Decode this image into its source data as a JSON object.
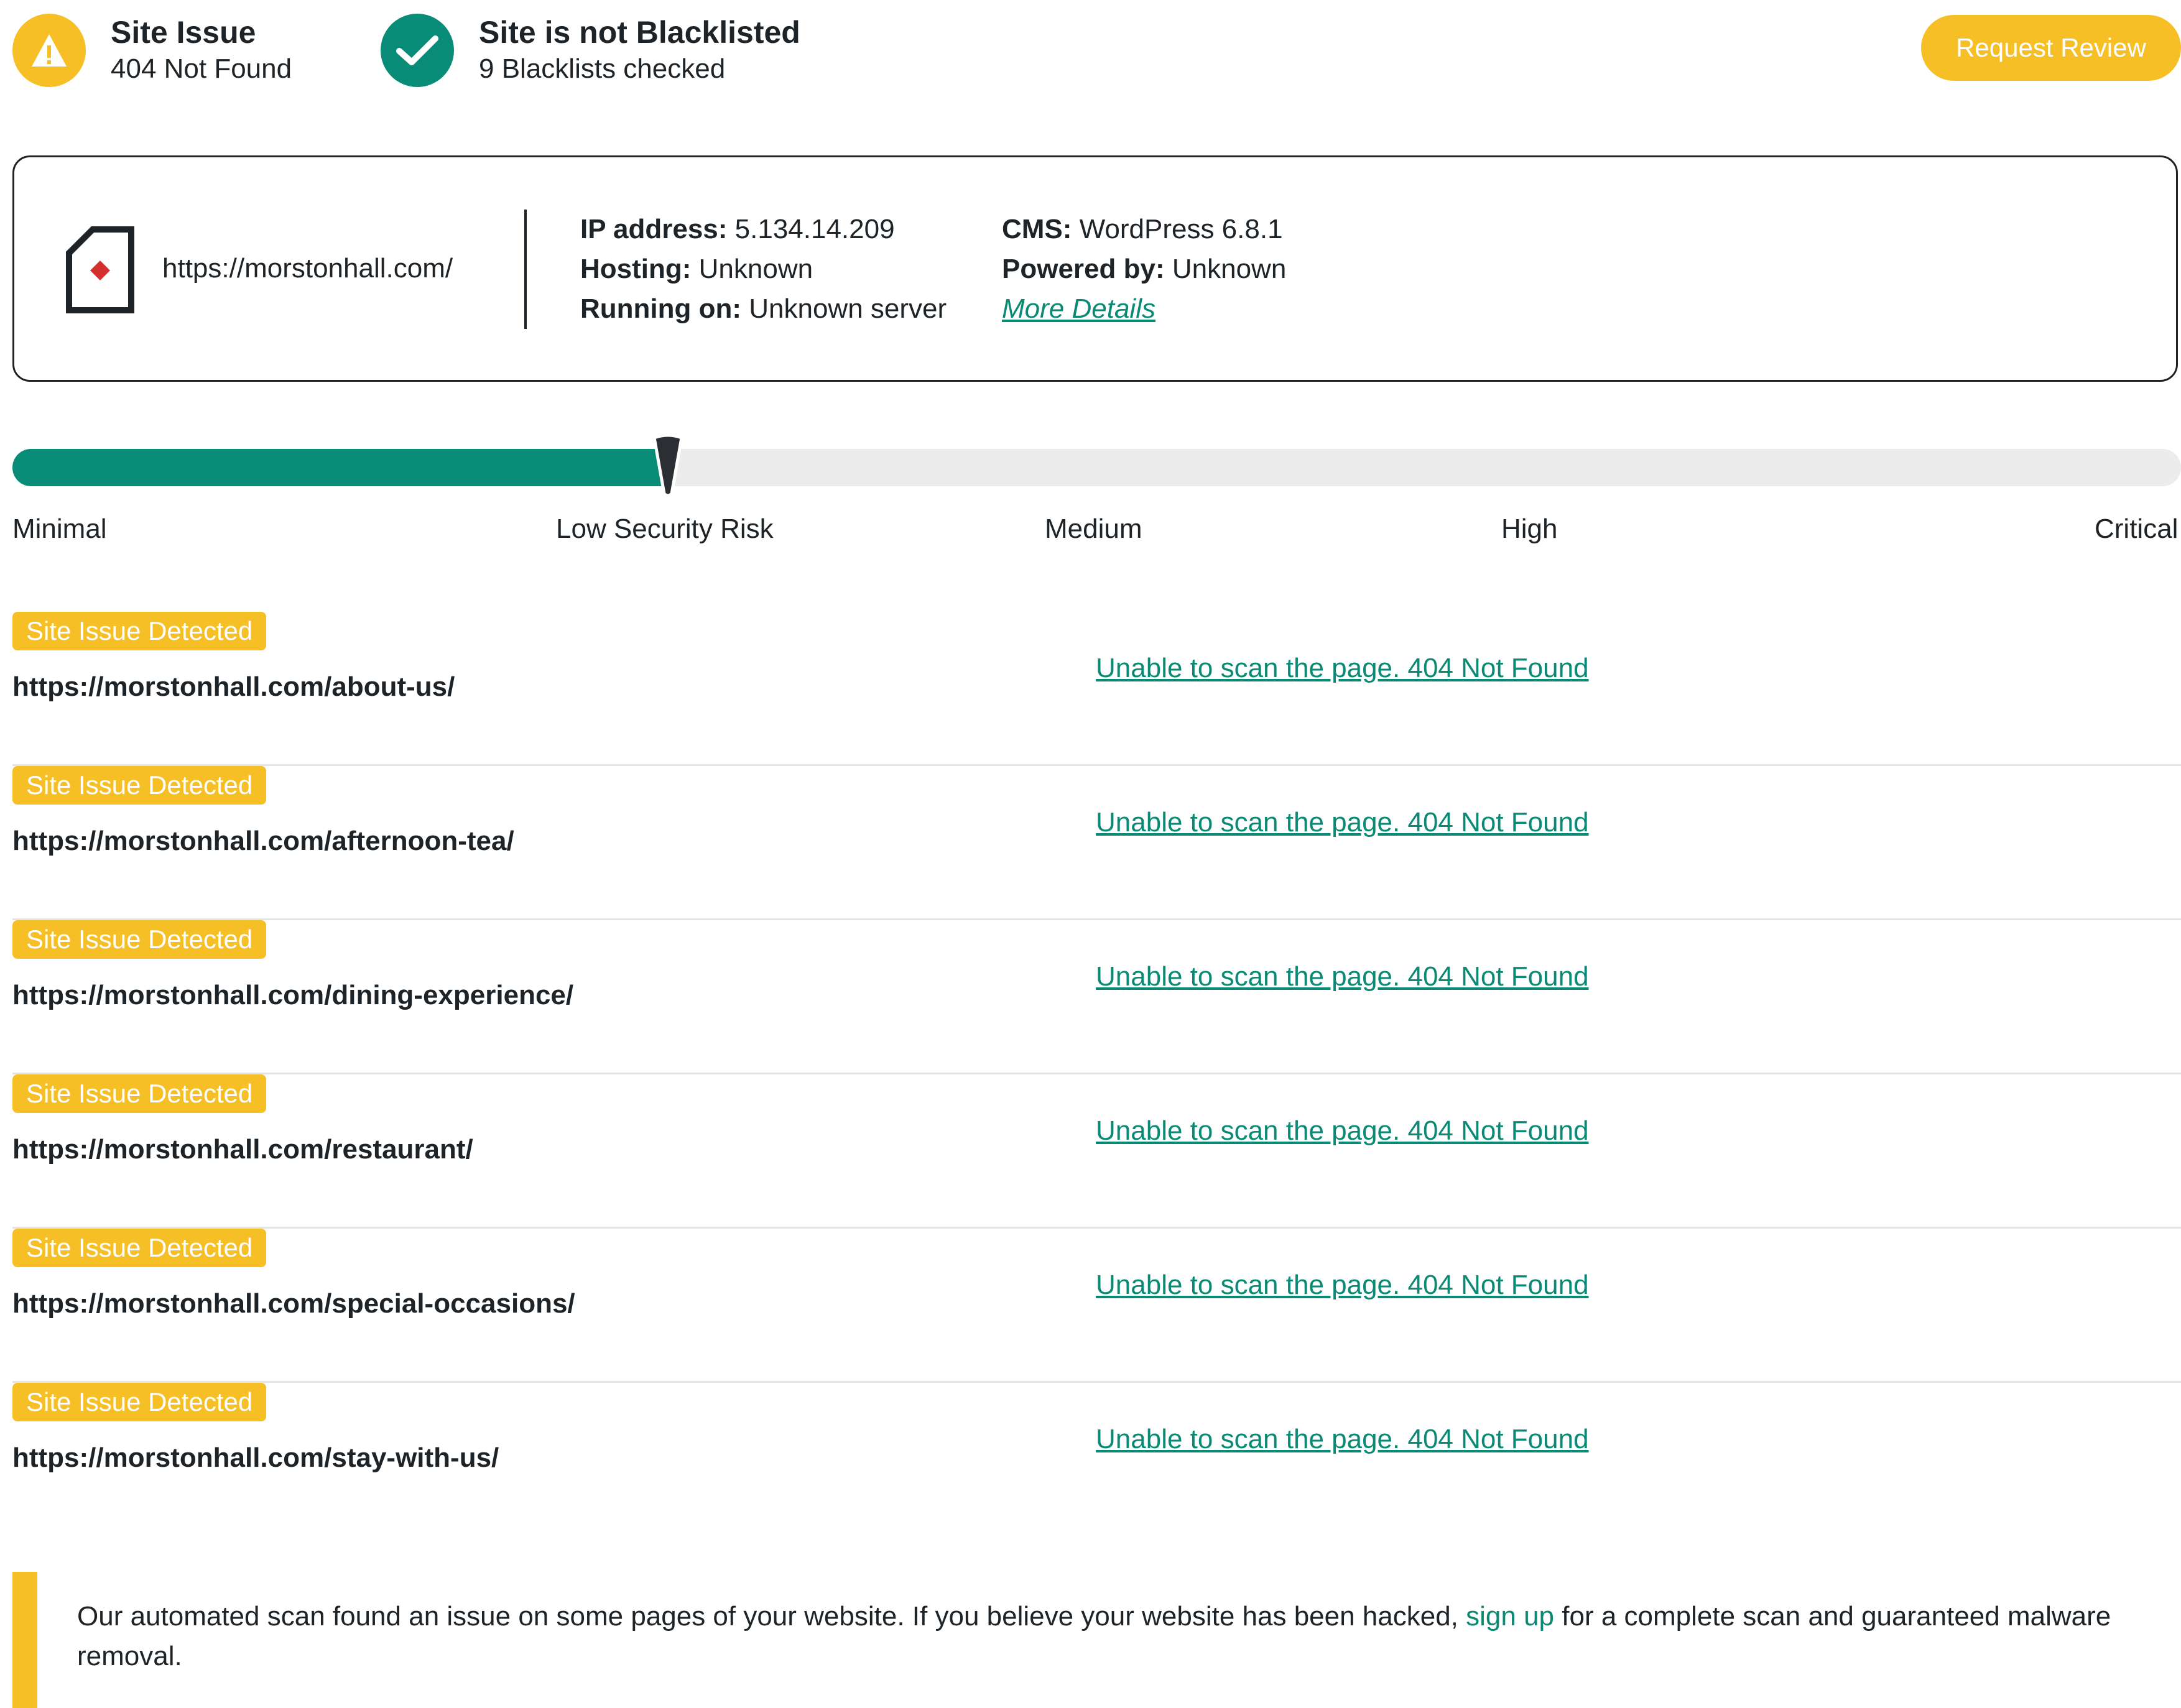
{
  "header": {
    "site_issue": {
      "title": "Site Issue",
      "subtitle": "404 Not Found",
      "icon": "warning-icon",
      "color": "#f6bf26"
    },
    "blacklist": {
      "title": "Site is not Blacklisted",
      "subtitle": "9 Blacklists checked",
      "icon": "check-icon",
      "color": "#098c77"
    },
    "request_review_label": "Request Review"
  },
  "site_info": {
    "url": "https://morstonhall.com/",
    "ip_label": "IP address:",
    "ip_value": " 5.134.14.209",
    "hosting_label": "Hosting:",
    "hosting_value": " Unknown",
    "running_label": "Running on:",
    "running_value": " Unknown server",
    "cms_label": "CMS:",
    "cms_value": " WordPress 6.8.1",
    "powered_label": "Powered by:",
    "powered_value": " Unknown",
    "more_details": "More Details"
  },
  "risk": {
    "level": "Low Security Risk",
    "labels": [
      "Minimal",
      "Low Security Risk",
      "Medium",
      "High",
      "Critical"
    ],
    "accent": "#098c77"
  },
  "issues": [
    {
      "tag": "Site Issue Detected",
      "url": "https://morstonhall.com/about-us/",
      "status": "Unable to scan the page. 404 Not Found"
    },
    {
      "tag": "Site Issue Detected",
      "url": "https://morstonhall.com/afternoon-tea/",
      "status": "Unable to scan the page. 404 Not Found"
    },
    {
      "tag": "Site Issue Detected",
      "url": "https://morstonhall.com/dining-experience/",
      "status": "Unable to scan the page. 404 Not Found"
    },
    {
      "tag": "Site Issue Detected",
      "url": "https://morstonhall.com/restaurant/",
      "status": "Unable to scan the page. 404 Not Found"
    },
    {
      "tag": "Site Issue Detected",
      "url": "https://morstonhall.com/special-occasions/",
      "status": "Unable to scan the page. 404 Not Found"
    },
    {
      "tag": "Site Issue Detected",
      "url": "https://morstonhall.com/stay-with-us/",
      "status": "Unable to scan the page. 404 Not Found"
    }
  ],
  "notice": {
    "text_before": "Our automated scan found an issue on some pages of your website. If you believe your website has been hacked, ",
    "link": "sign up",
    "text_after": " for a complete scan and guaranteed malware removal."
  }
}
